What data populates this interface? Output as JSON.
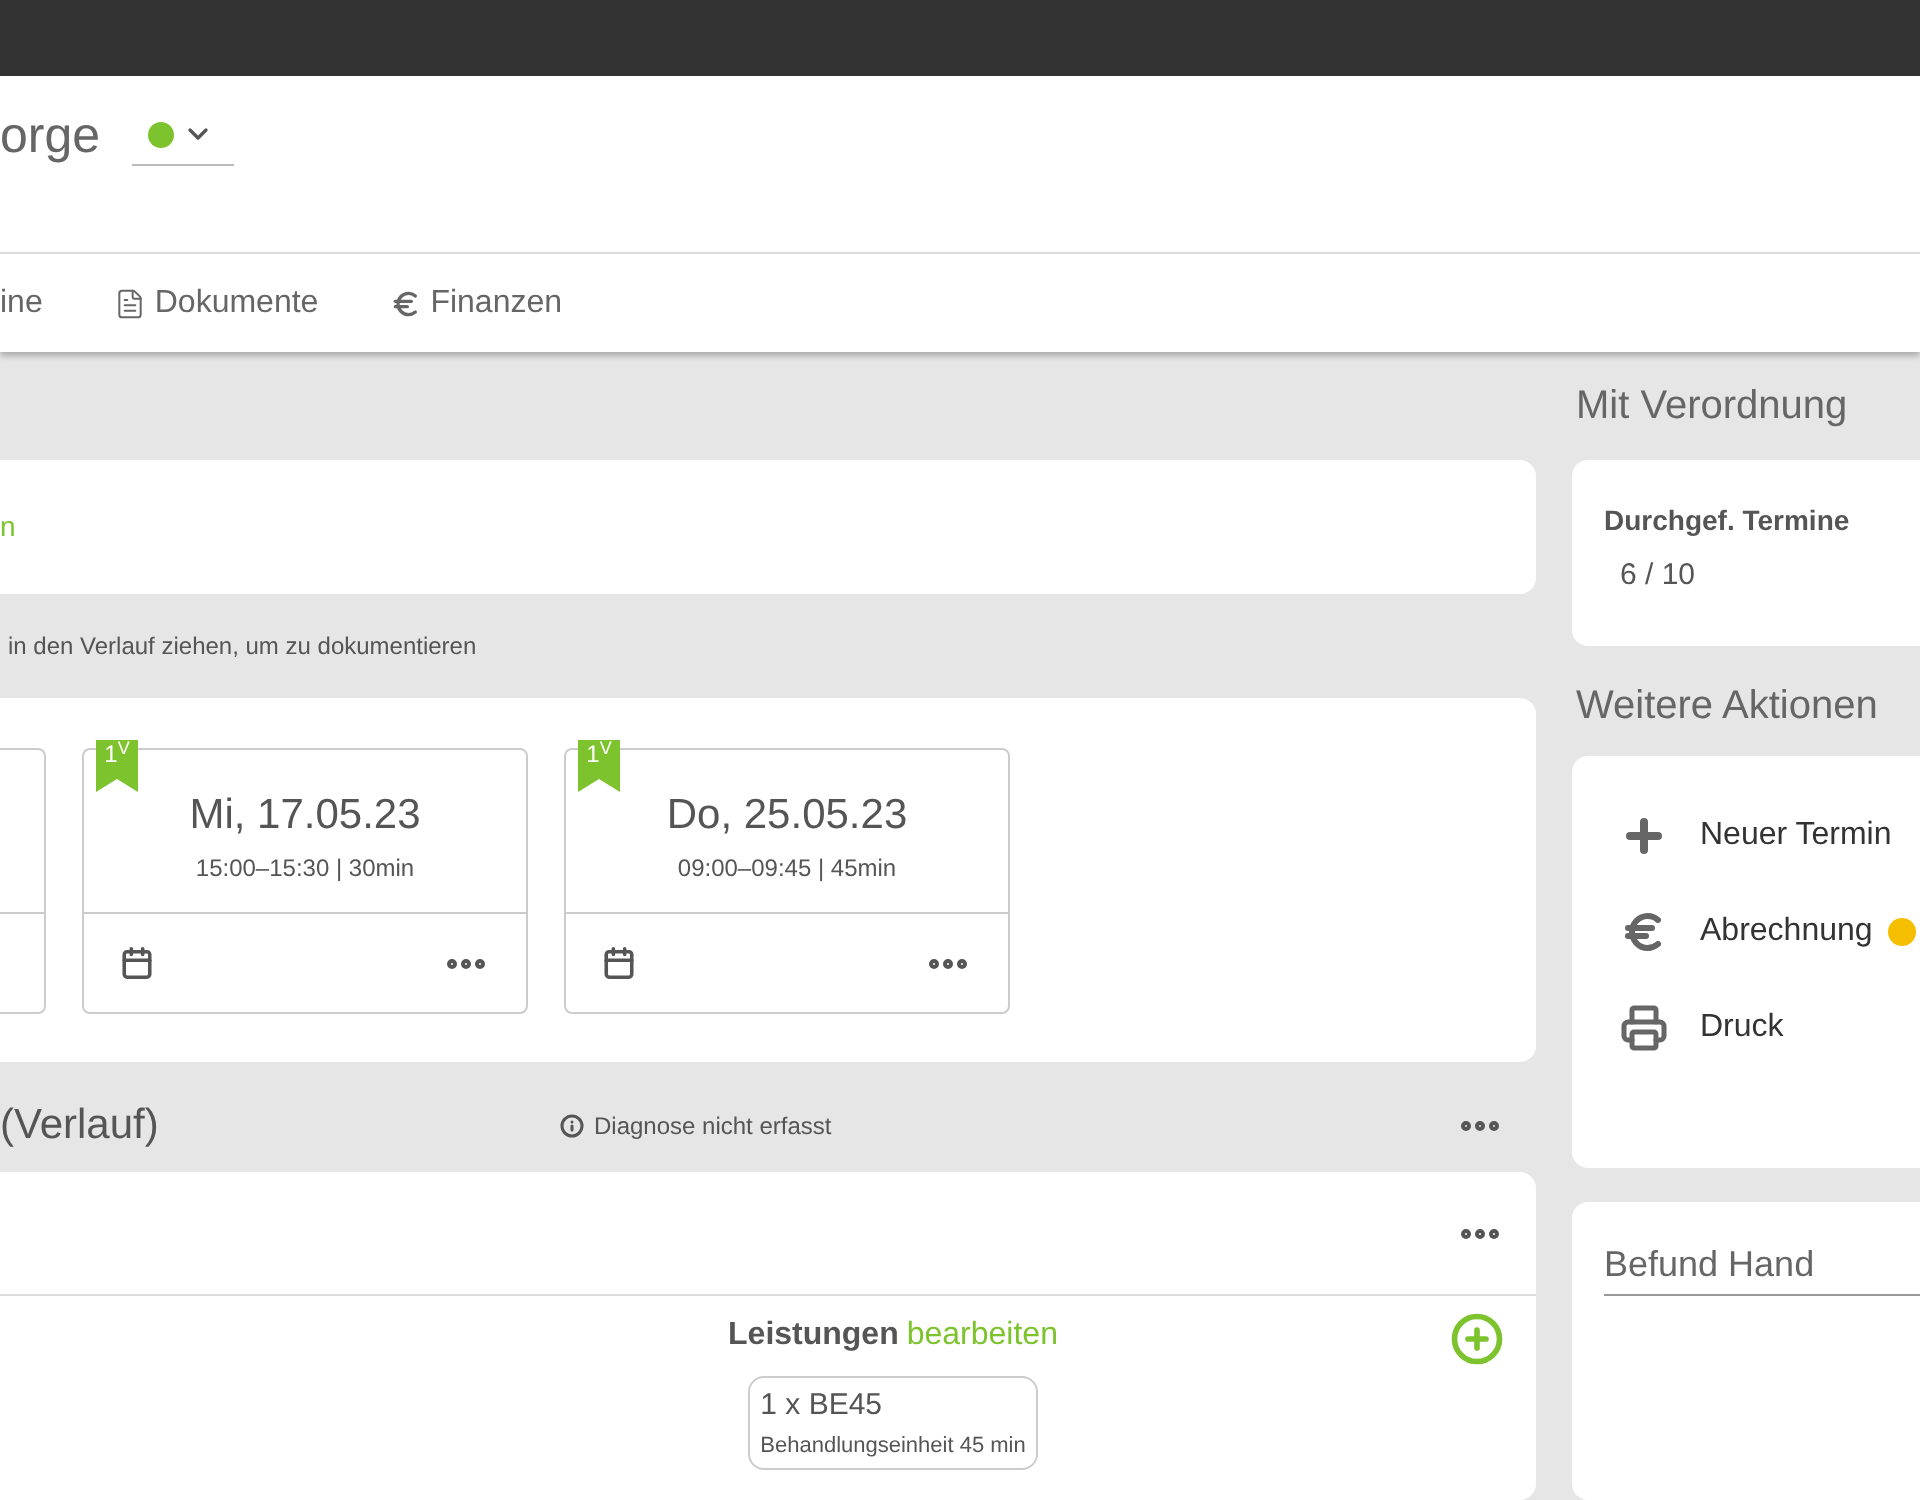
{
  "header": {
    "title": "orge",
    "status": {
      "color": "#7dc32e"
    }
  },
  "tabs": [
    {
      "label": "ine",
      "kind": "plain",
      "selected": false
    },
    {
      "label": "Dokumente",
      "kind": "document",
      "selected": false
    },
    {
      "label": "Finanzen",
      "kind": "finance",
      "selected": false
    }
  ],
  "top_card": {
    "link": "n"
  },
  "hint": "in den Verlauf ziehen, um zu dokumentieren",
  "appointments": [
    {
      "kind": "partial"
    },
    {
      "kind": "card",
      "badge": "1$^{V}$",
      "date": "Mi, 17.05.23",
      "time": "15:00–15:30 | 30min"
    },
    {
      "kind": "card",
      "badge": "1$^{V}$",
      "date": "Do, 25.05.23",
      "time": "09:00–09:45 | 45min"
    }
  ],
  "history": {
    "title": "(Verlauf)",
    "notice": "Diagnose nicht erfasst",
    "services_label": "Leistungen",
    "services_link": "bearbeiten",
    "services": [
      {
        "code": "1 x BE45",
        "description": "Behandlungseinheit 45 min"
      }
    ]
  },
  "prescription": {
    "title": "Mit Verordnung",
    "label": "Durchgef. Termine",
    "value": "6 / 10"
  },
  "actions": {
    "title": "Weitere Aktionen",
    "items": [
      {
        "kind": "create",
        "label": "Neuer Termin"
      },
      {
        "kind": "billing",
        "label": "Abrechnung",
        "color": "#f5bf00"
      },
      {
        "kind": "print",
        "label": "Druck"
      }
    ]
  },
  "findings": {
    "title": "Befund Hand"
  }
}
